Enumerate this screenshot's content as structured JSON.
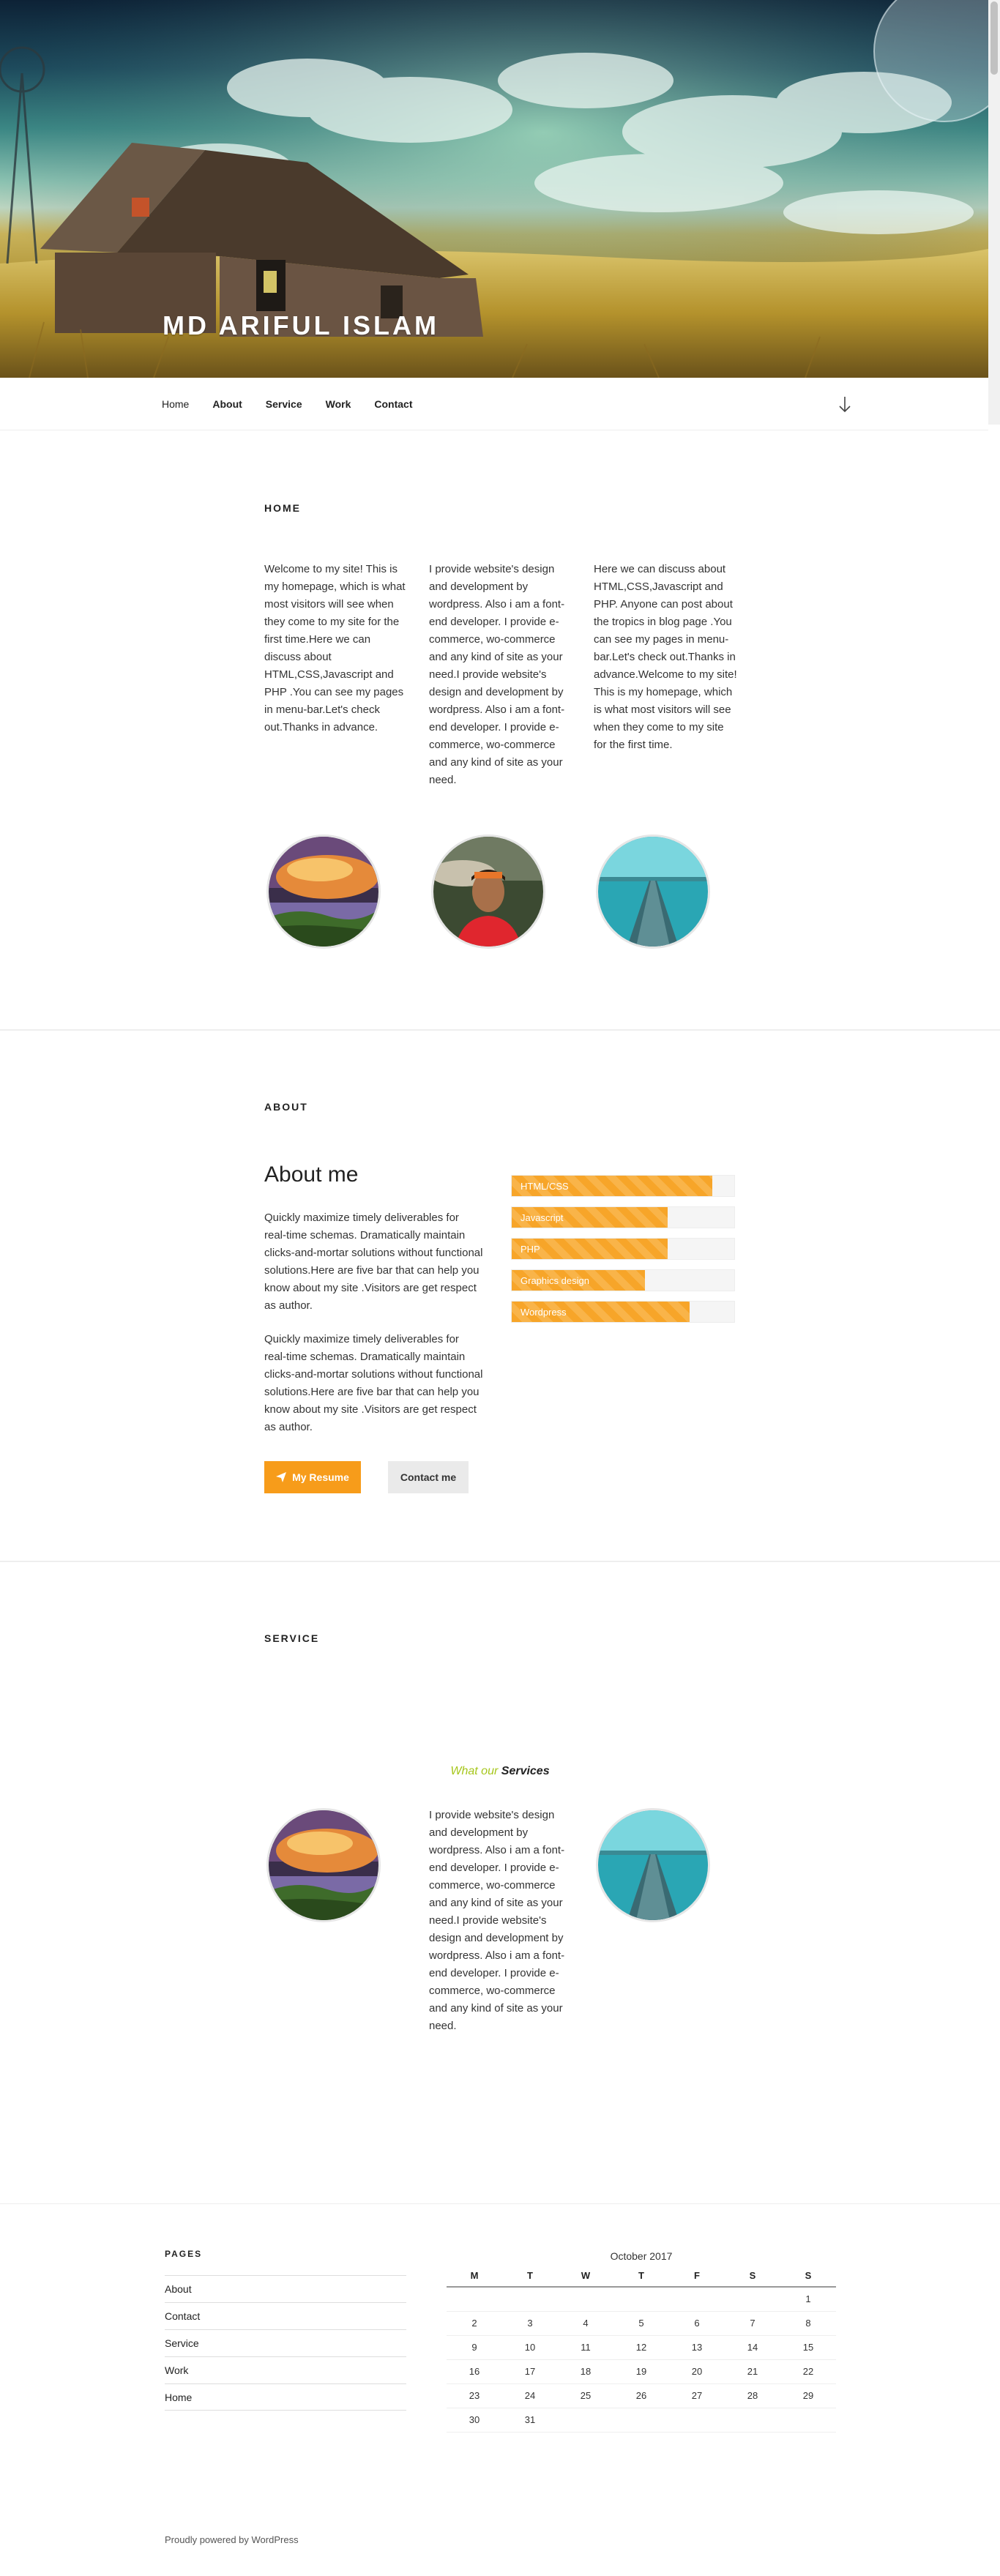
{
  "site": {
    "title": "MD ARIFUL ISLAM"
  },
  "nav": {
    "items": [
      "Home",
      "About",
      "Service",
      "Work",
      "Contact"
    ]
  },
  "home": {
    "label": "HOME",
    "col1": "Welcome to my site! This is my homepage, which is what most visitors will see when they come to my site for the first time.Here we can discuss about HTML,CSS,Javascript and PHP .You can see my pages in menu-bar.Let's check out.Thanks in advance.",
    "col2": "I  provide website's design and development by wordpress. Also i am a font-end developer. I provide e-commerce, wo-commerce and any kind of site as your need.I  provide website's design and development by wordpress. Also i am a font-end developer. I provide e-commerce, wo-commerce and any kind of site as your need.",
    "col3": "Here we can discuss about HTML,CSS,Javascript and PHP. Anyone can post about the tropics in blog page .You can see my pages in menu-bar.Let's check out.Thanks in advance.Welcome to my site! This is my homepage, which is what most visitors will see when they come to my site for the first time."
  },
  "about": {
    "label": "ABOUT",
    "heading": "About me",
    "p1": "Quickly maximize timely deliverables for real-time schemas. Dramatically maintain clicks-and-mortar solutions without functional solutions.Here are five bar that can help you know about my site .Visitors are get respect as author.",
    "p2": "Quickly maximize timely deliverables for real-time schemas. Dramatically maintain clicks-and-mortar solutions without functional solutions.Here are five bar that can help you know about my site .Visitors are get respect as author.",
    "skills": [
      {
        "label": "HTML/CSS",
        "level": 0.9
      },
      {
        "label": "Javascript",
        "level": 0.7
      },
      {
        "label": "PHP",
        "level": 0.7
      },
      {
        "label": "Graphics design",
        "level": 0.6
      },
      {
        "label": "Wordpress",
        "level": 0.8
      }
    ],
    "resume_label": "My Resume",
    "contact_label": "Contact me",
    "accent_color": "#f79c1a"
  },
  "service": {
    "label": "SERVICE",
    "title_a": "What our",
    "title_b": "Services",
    "text": "I  provide website's design and development by wordpress. Also i am a font-end developer. I provide e-commerce, wo-commerce and any kind of site as your need.I  provide website's design and development by wordpress. Also i am a font-end developer. I provide e-commerce, wo-commerce and any kind of site as your need."
  },
  "footer": {
    "pages_title": "PAGES",
    "pages": [
      "About",
      "Contact",
      "Service",
      "Work",
      "Home"
    ],
    "calendar": {
      "caption": "October 2017",
      "days": [
        "M",
        "T",
        "W",
        "T",
        "F",
        "S",
        "S"
      ],
      "weeks": [
        [
          "",
          "",
          "",
          "",
          "",
          "",
          "1"
        ],
        [
          "2",
          "3",
          "4",
          "5",
          "6",
          "7",
          "8"
        ],
        [
          "9",
          "10",
          "11",
          "12",
          "13",
          "14",
          "15"
        ],
        [
          "16",
          "17",
          "18",
          "19",
          "20",
          "21",
          "22"
        ],
        [
          "23",
          "24",
          "25",
          "26",
          "27",
          "28",
          "29"
        ],
        [
          "30",
          "31",
          "",
          "",
          "",
          "",
          ""
        ]
      ]
    },
    "credit": "Proudly powered by WordPress"
  }
}
